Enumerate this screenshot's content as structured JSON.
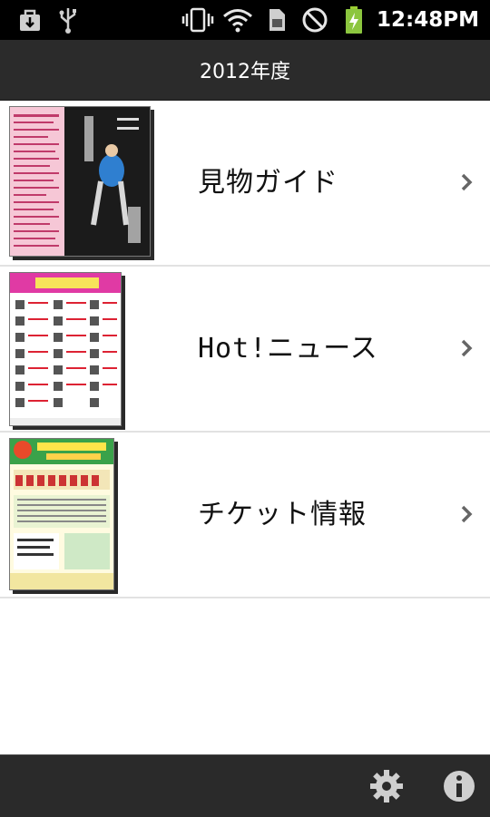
{
  "status_bar": {
    "time": "12:48PM",
    "icons": [
      "download-icon",
      "usb-icon",
      "vibrate-icon",
      "wifi-icon",
      "sim-icon",
      "no-signal-icon",
      "battery-charging-icon"
    ]
  },
  "title_bar": {
    "title": "2012年度"
  },
  "list": {
    "items": [
      {
        "label": "見物ガイド",
        "thumbnail": "guide-poster-thumbnail"
      },
      {
        "label": "Hot!ニュース",
        "thumbnail": "news-poster-thumbnail"
      },
      {
        "label": "チケット情報",
        "thumbnail": "ticket-poster-thumbnail"
      }
    ]
  },
  "bottom_bar": {
    "buttons": [
      "settings-gear-icon",
      "info-icon"
    ]
  },
  "colors": {
    "status_bar_bg": "#000000",
    "title_bar_bg": "#2b2b2b",
    "bottom_bar_bg": "#2a2a2a",
    "list_bg": "#ffffff",
    "divider": "#e2e2e2"
  }
}
